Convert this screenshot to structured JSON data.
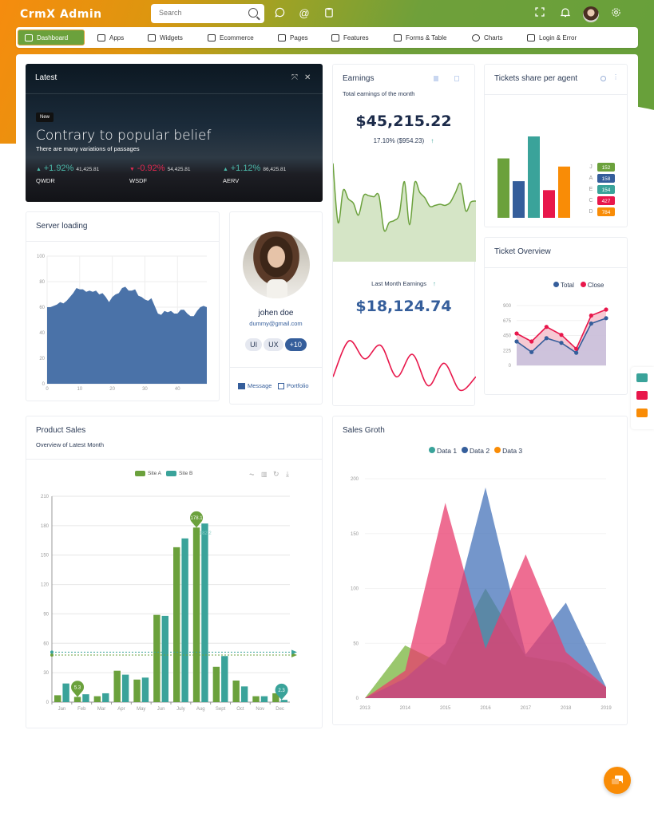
{
  "header": {
    "app_title": "CrmX Admin",
    "search_placeholder": "Search",
    "icons": [
      "chat-icon",
      "at-icon",
      "clipboard-icon",
      "fullscreen-icon",
      "bell-icon",
      "avatar",
      "gear-icon"
    ]
  },
  "nav": [
    {
      "label": "Dashboard",
      "icon": "monitor-icon",
      "active": true
    },
    {
      "label": "Apps",
      "icon": "grid-icon"
    },
    {
      "label": "Widgets",
      "icon": "edit-icon"
    },
    {
      "label": "Ecommerce",
      "icon": "cart-icon"
    },
    {
      "label": "Pages",
      "icon": "cast-icon"
    },
    {
      "label": "Features",
      "icon": "box-icon"
    },
    {
      "label": "Forms & Table",
      "icon": "inbox-icon"
    },
    {
      "label": "Charts",
      "icon": "pie-icon"
    },
    {
      "label": "Login & Error",
      "icon": "lock-icon"
    }
  ],
  "latest": {
    "title": "Latest",
    "badge": "New",
    "headline": "Contrary to popular belief",
    "subtitle": "There are many variations of passages",
    "stocks": [
      {
        "change": "+1.92%",
        "value": "41,425.81",
        "name": "QWDR",
        "direction": "up"
      },
      {
        "change": "-0.92%",
        "value": "54,425.81",
        "name": "WSDF",
        "direction": "down"
      },
      {
        "change": "+1.12%",
        "value": "86,425.81",
        "name": "AERV",
        "direction": "up"
      }
    ]
  },
  "earnings": {
    "title": "Earnings",
    "subtitle": "Total earnings of the month",
    "amount": "$45,215.22",
    "change": "17.10% ($954.23)",
    "last_month_label": "Last Month Earnings",
    "last_month_amount": "$18,124.74"
  },
  "tickets": {
    "title": "Tickets share per agent",
    "agents": [
      {
        "letter": "J",
        "value": "152",
        "color": "#6ba13c"
      },
      {
        "letter": "A",
        "value": "158",
        "color": "#355e9b"
      },
      {
        "letter": "E",
        "value": "154",
        "color": "#3aa39a"
      },
      {
        "letter": "C",
        "value": "427",
        "color": "#e8174b"
      },
      {
        "letter": "D",
        "value": "784",
        "color": "#f98c06"
      }
    ]
  },
  "server": {
    "title": "Server loading"
  },
  "profile": {
    "name": "johen doe",
    "email": "dummy@gmail.com",
    "tags": [
      "UI",
      "UX",
      "+10"
    ],
    "message_label": "Message",
    "portfolio_label": "Portfolio"
  },
  "overview": {
    "title": "Ticket Overview",
    "legend": [
      "Total",
      "Close"
    ]
  },
  "product": {
    "title": "Product Sales",
    "subtitle": "Overview of Latest Month",
    "legend": [
      "Site A",
      "Site B"
    ]
  },
  "groth": {
    "title": "Sales Groth",
    "legend": [
      "Data 1",
      "Data 2",
      "Data 3"
    ]
  },
  "colors": {
    "green": "#6ba13c",
    "teal": "#3aa39a",
    "blue": "#355e9b",
    "red": "#e8174b",
    "orange": "#f98c06"
  },
  "chart_data": [
    {
      "id": "tickets-share",
      "type": "bar",
      "title": "Tickets share per agent",
      "categories": [
        "J",
        "A",
        "E",
        "C",
        "D"
      ],
      "values": [
        152,
        158,
        154,
        427,
        784
      ],
      "bar_heights_relative": [
        0.73,
        0.45,
        1.0,
        0.34,
        0.63
      ]
    },
    {
      "id": "server-loading",
      "type": "area",
      "title": "Server loading",
      "x_range": [
        0,
        49
      ],
      "ylim": [
        0,
        100
      ],
      "xticks": [
        0,
        10,
        20,
        30,
        40
      ],
      "yticks": [
        0,
        20,
        40,
        60,
        80,
        100
      ],
      "values": [
        60,
        60,
        61,
        62,
        64,
        63,
        65,
        68,
        71,
        75,
        74,
        74,
        72,
        73,
        72,
        73,
        70,
        71,
        68,
        64,
        68,
        70,
        71,
        75,
        76,
        73,
        73,
        74,
        69,
        68,
        66,
        65,
        67,
        61,
        55,
        54,
        57,
        56,
        57,
        55,
        55,
        58,
        58,
        55,
        53,
        53,
        57,
        60,
        61,
        60
      ]
    },
    {
      "id": "earnings-sparkline",
      "type": "area",
      "values": [
        95,
        40,
        70,
        62,
        58,
        47,
        65,
        65,
        64,
        65,
        33,
        40,
        42,
        48,
        78,
        38,
        77,
        68,
        63,
        55,
        56,
        57,
        56,
        59,
        68,
        76,
        51,
        59,
        60
      ]
    },
    {
      "id": "last-month-sparkline",
      "type": "line",
      "values": [
        30,
        70,
        50,
        65,
        30,
        55,
        20,
        45,
        15,
        30
      ]
    },
    {
      "id": "ticket-overview",
      "type": "area",
      "title": "Ticket Overview",
      "ylim": [
        0,
        900
      ],
      "yticks": [
        0,
        225,
        450,
        675,
        900
      ],
      "series": [
        {
          "name": "Total",
          "values": [
            360,
            200,
            410,
            340,
            190,
            630,
            710
          ]
        },
        {
          "name": "Close",
          "values": [
            480,
            360,
            580,
            460,
            250,
            750,
            840
          ]
        }
      ]
    },
    {
      "id": "product-sales",
      "type": "bar",
      "title": "Product Sales",
      "categories": [
        "Jan",
        "Feb",
        "Mar",
        "Apr",
        "May",
        "Jun",
        "July",
        "Aug",
        "Sept",
        "Oct",
        "Nov",
        "Dec"
      ],
      "ylim": [
        0,
        210
      ],
      "yticks": [
        0,
        30,
        60,
        90,
        120,
        150,
        180,
        210
      ],
      "series": [
        {
          "name": "Site A",
          "values": [
            7,
            5.3,
            6,
            32,
            23,
            89,
            158,
            178.1,
            36,
            22,
            6,
            9
          ],
          "avg": 48
        },
        {
          "name": "Site B",
          "values": [
            19,
            8,
            9,
            28,
            25,
            88,
            167,
            182.2,
            47,
            16,
            6,
            2.3
          ],
          "avg": 51
        }
      ],
      "markpoints": [
        {
          "series": "Site A",
          "label": "5.3"
        },
        {
          "series": "Site A",
          "label": "178.1"
        },
        {
          "series": "Site B",
          "label": "182.2"
        },
        {
          "series": "Site B",
          "label": "2.3"
        }
      ]
    },
    {
      "id": "sales-groth",
      "type": "area",
      "title": "Sales Groth",
      "categories": [
        "2013",
        "2014",
        "2015",
        "2016",
        "2017",
        "2018",
        "2019"
      ],
      "ylim": [
        0,
        200
      ],
      "yticks": [
        0,
        50,
        100,
        150,
        200
      ],
      "series": [
        {
          "name": "Data 1",
          "values": [
            0,
            48,
            30,
            100,
            38,
            32,
            10
          ]
        },
        {
          "name": "Data 2",
          "values": [
            0,
            18,
            50,
            192,
            40,
            87,
            10
          ]
        },
        {
          "name": "Data 3",
          "values": [
            0,
            25,
            178,
            45,
            131,
            42,
            10
          ]
        }
      ]
    }
  ]
}
